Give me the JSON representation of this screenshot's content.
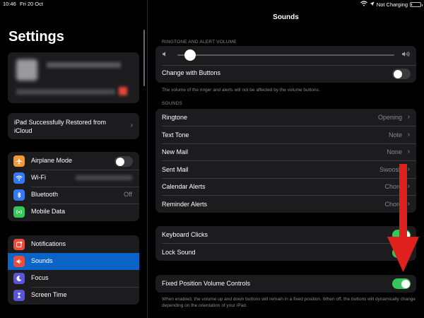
{
  "status_bar": {
    "time": "10:46",
    "date": "Fri 20 Oct",
    "charging": "Not Charging",
    "battery_level": 0.1
  },
  "sidebar": {
    "title": "Settings",
    "restored_banner": "iPad Successfully Restored from iCloud",
    "connectivity": [
      {
        "label": "Airplane Mode",
        "icon": "airplane-icon",
        "icon_color": "#f09a37",
        "control": "toggle",
        "on": false
      },
      {
        "label": "Wi-Fi",
        "icon": "wifi-icon",
        "icon_color": "#3478f6",
        "control": "blurred"
      },
      {
        "label": "Bluetooth",
        "icon": "bluetooth-icon",
        "icon_color": "#3478f6",
        "value": "Off"
      },
      {
        "label": "Mobile Data",
        "icon": "mobile-data-icon",
        "icon_color": "#34c759"
      }
    ],
    "general": [
      {
        "label": "Notifications",
        "icon": "notifications-icon",
        "icon_color": "#eb4d3d"
      },
      {
        "label": "Sounds",
        "icon": "sounds-icon",
        "icon_color": "#eb4d3d",
        "selected": true
      },
      {
        "label": "Focus",
        "icon": "focus-icon",
        "icon_color": "#5856d6"
      },
      {
        "label": "Screen Time",
        "icon": "screen-time-icon",
        "icon_color": "#5856d6"
      }
    ]
  },
  "detail": {
    "title": "Sounds",
    "volume_header": "RINGTONE AND ALERT VOLUME",
    "volume_level": 0.06,
    "change_with_buttons": {
      "label": "Change with Buttons",
      "on": false
    },
    "volume_footer": "The volume of the ringer and alerts will not be affected by the volume buttons.",
    "sounds_header": "SOUNDS",
    "sounds": [
      {
        "label": "Ringtone",
        "value": "Opening"
      },
      {
        "label": "Text Tone",
        "value": "Note"
      },
      {
        "label": "New Mail",
        "value": "None"
      },
      {
        "label": "Sent Mail",
        "value": "Swoosh"
      },
      {
        "label": "Calendar Alerts",
        "value": "Chord"
      },
      {
        "label": "Reminder Alerts",
        "value": "Chord"
      }
    ],
    "feedback": [
      {
        "label": "Keyboard Clicks",
        "on": true
      },
      {
        "label": "Lock Sound",
        "on": true
      }
    ],
    "fixed_position": {
      "label": "Fixed Position Volume Controls",
      "on": true
    },
    "fixed_footer": "When enabled, the volume up and down buttons will remain in a fixed position. When off, the buttons will dynamically change depending on the orientation of your iPad."
  },
  "colors": {
    "accent": "#0a64c8",
    "toggle_on": "#34c759",
    "annotation_arrow": "#e0201c"
  }
}
